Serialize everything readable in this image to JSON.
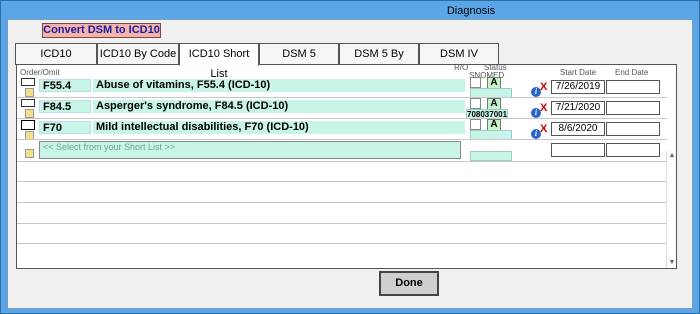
{
  "window": {
    "title": "Diagnosis"
  },
  "convert_button": {
    "label": "Convert DSM to ICD10"
  },
  "tabs": [
    {
      "label": "ICD10"
    },
    {
      "label": "ICD10 By Code"
    },
    {
      "label": "ICD10 Short List",
      "active": true
    },
    {
      "label": "DSM 5"
    },
    {
      "label": "DSM 5 By Code"
    },
    {
      "label": "DSM IV"
    }
  ],
  "grid": {
    "headers": {
      "order_omit": "Order/Omit",
      "ro": "R/O",
      "status": "Status",
      "snomed": "SNOMED",
      "start_date": "Start Date",
      "end_date": "End Date"
    },
    "rows": [
      {
        "code": "F55.4",
        "description": "Abuse of vitamins, F55.4 (ICD-10)",
        "status": "A",
        "snomed": "",
        "start_date": "7/26/2019",
        "end_date": ""
      },
      {
        "code": "F84.5",
        "description": "Asperger's syndrome, F84.5 (ICD-10)",
        "status": "A",
        "snomed": "708037001",
        "start_date": "7/21/2020",
        "end_date": ""
      },
      {
        "code": "F70",
        "description": "Mild intellectual disabilities, F70 (ICD-10)",
        "status": "A",
        "snomed": "",
        "start_date": "8/6/2020",
        "end_date": ""
      }
    ],
    "select_placeholder": "<< Select from your Short List >>"
  },
  "icons": {
    "info": "info-icon",
    "delete": "delete-x-icon"
  },
  "colors": {
    "window_bg": "#5aa6e6",
    "field_bg": "#c8f5e8",
    "convert_bg": "#f4b5a8",
    "delete": "#cc0000"
  },
  "done_button": {
    "label": "Done"
  }
}
